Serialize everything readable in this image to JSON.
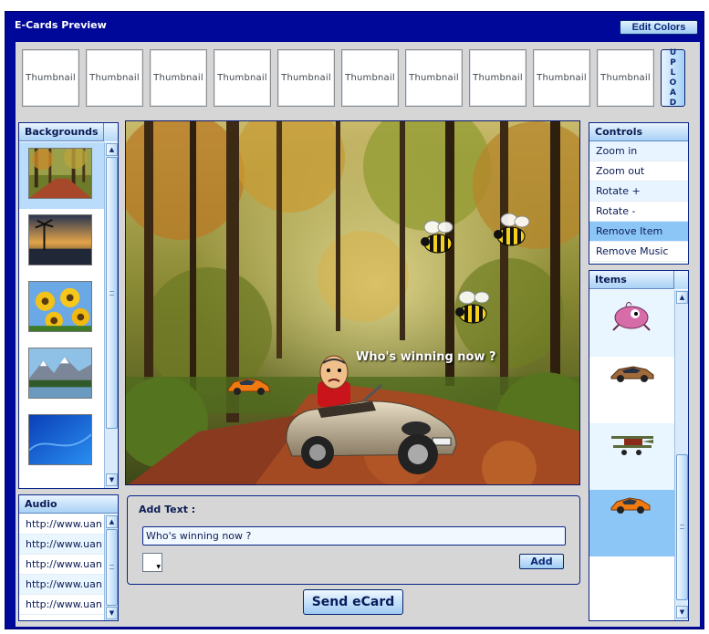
{
  "window": {
    "title": "E-Cards Preview",
    "edit_colors_label": "Edit Colors"
  },
  "thumbnails": [
    "Thumbnail",
    "Thumbnail",
    "Thumbnail",
    "Thumbnail",
    "Thumbnail",
    "Thumbnail",
    "Thumbnail",
    "Thumbnail",
    "Thumbnail",
    "Thumbnail"
  ],
  "upload": {
    "letters": [
      "U",
      "P",
      "L",
      "O",
      "A",
      "D"
    ]
  },
  "backgrounds": {
    "title": "Backgrounds",
    "selected_index": 0
  },
  "stage": {
    "caption": "Who's winning now ?"
  },
  "controls": {
    "title": "Controls",
    "items": [
      "Zoom in",
      "Zoom out",
      "Rotate +",
      "Rotate -",
      "Remove Item",
      "Remove Music"
    ],
    "selected_index": 4
  },
  "items_panel": {
    "title": "Items",
    "selected_index": 3
  },
  "audio": {
    "title": "Audio",
    "items": [
      "http://www.uan",
      "http://www.uan",
      "http://www.uan",
      "http://www.uan",
      "http://www.uan"
    ]
  },
  "add_text": {
    "label": "Add Text :",
    "value": "Who's winning now ?",
    "add_label": "Add"
  },
  "send_label": "Send eCard",
  "colors": {
    "frame": "#00089a",
    "panel_header": "#a9d1f5",
    "selection": "#8cc6f7",
    "content_bg": "#d6d6d6"
  }
}
